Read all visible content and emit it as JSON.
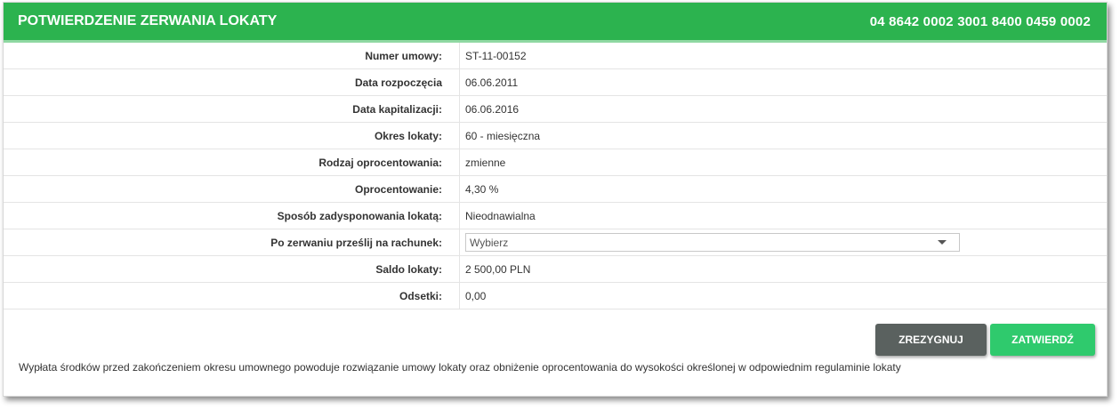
{
  "header": {
    "title": "POTWIERDZENIE ZERWANIA LOKATY",
    "account_number": "04 8642 0002 3001 8400 0459 0002"
  },
  "fields": [
    {
      "label": "Numer umowy:",
      "value": "ST-11-00152"
    },
    {
      "label": "Data rozpoczęcia",
      "value": "06.06.2011"
    },
    {
      "label": "Data kapitalizacji:",
      "value": "06.06.2016"
    },
    {
      "label": "Okres lokaty:",
      "value": "60 - miesięczna"
    },
    {
      "label": "Rodzaj oprocentowania:",
      "value": "zmienne"
    },
    {
      "label": "Oprocentowanie:",
      "value": "4,30 %"
    },
    {
      "label": "Sposób zadysponowania lokatą:",
      "value": "Nieodnawialna"
    },
    {
      "label": "Po zerwaniu prześlij na rachunek:",
      "value": "Wybierz",
      "type": "select"
    },
    {
      "label": "Saldo lokaty:",
      "value": "2 500,00 PLN"
    },
    {
      "label": "Odsetki:",
      "value": "0,00"
    }
  ],
  "buttons": {
    "cancel_label": "ZREZYGNUJ",
    "confirm_label": "ZATWIERDŹ"
  },
  "note": "Wypłata środków przed zakończeniem okresu umownego powoduje rozwiązanie umowy lokaty oraz obniżenie oprocentowania do wysokości określonej w odpowiednim regulaminie lokaty",
  "colors": {
    "header_green": "#2cb34f",
    "confirm_green": "#2fca6d",
    "cancel_gray": "#5a615f"
  },
  "icons": {
    "select_caret": "chevron-down-icon"
  }
}
